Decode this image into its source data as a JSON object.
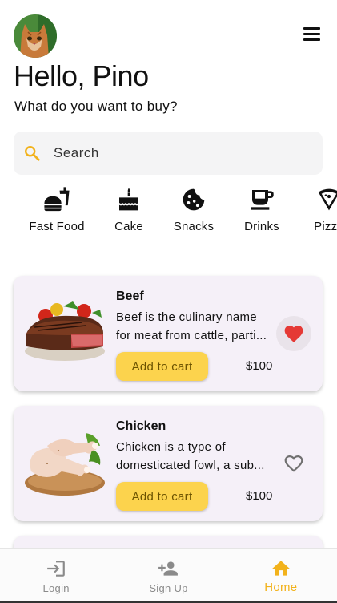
{
  "header": {
    "avatar_icon": "cat-avatar",
    "menu_icon": "hamburger-menu-icon",
    "greeting": "Hello, Pino",
    "subtitle": "What do you want to buy?"
  },
  "search": {
    "placeholder": "Search",
    "icon": "search-icon"
  },
  "categories": [
    {
      "label": "Fast Food",
      "icon": "fast-food-icon"
    },
    {
      "label": "Cake",
      "icon": "cake-icon"
    },
    {
      "label": "Snacks",
      "icon": "cookie-icon"
    },
    {
      "label": "Drinks",
      "icon": "cup-icon"
    },
    {
      "label": "Pizza",
      "icon": "pizza-icon"
    }
  ],
  "products": [
    {
      "title": "Beef",
      "desc_line1": "Beef is the culinary name",
      "desc_line2": "for meat from cattle, parti...",
      "add_label": "Add to cart",
      "price": "$100",
      "favorite": true
    },
    {
      "title": "Chicken",
      "desc_line1": "Chicken is a type of",
      "desc_line2": "domesticated fowl, a sub...",
      "add_label": "Add to cart",
      "price": "$100",
      "favorite": false
    }
  ],
  "bottom_nav": [
    {
      "label": "Login",
      "icon": "login-icon",
      "active": false
    },
    {
      "label": "Sign Up",
      "icon": "person-add-icon",
      "active": false
    },
    {
      "label": "Home",
      "icon": "home-icon",
      "active": true
    }
  ],
  "colors": {
    "accent": "#fcd34d",
    "active_nav": "#f2b21b",
    "favorite": "#e53935",
    "card_bg": "#f5f0f8"
  }
}
